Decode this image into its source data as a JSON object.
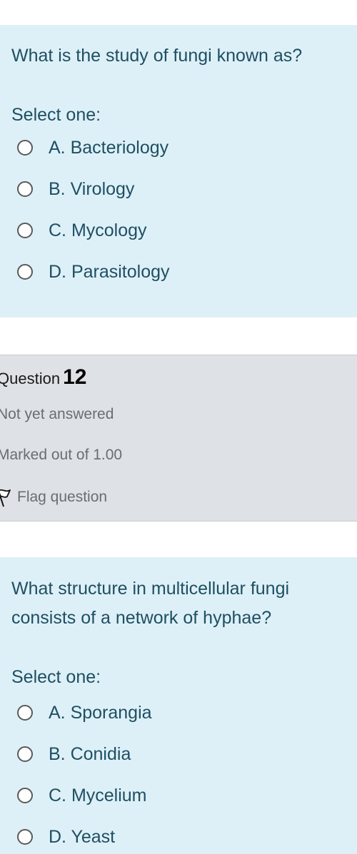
{
  "question11": {
    "text": "What is the study of fungi known as?",
    "select_label": "Select one:",
    "options": [
      {
        "label": "A. Bacteriology"
      },
      {
        "label": "B. Virology"
      },
      {
        "label": "C. Mycology"
      },
      {
        "label": "D. Parasitology"
      }
    ]
  },
  "question12_info": {
    "question_word": "Question",
    "number": "12",
    "status": "Not yet answered",
    "marks": "Marked out of 1.00",
    "flag_label": "Flag question",
    "flag_icon": "flag-outline-icon"
  },
  "question12": {
    "text": "What structure in multicellular fungi\nconsists of a network of hyphae?",
    "select_label": "Select one:",
    "options": [
      {
        "label": "A. Sporangia"
      },
      {
        "label": "B. Conidia"
      },
      {
        "label": "C. Mycelium"
      },
      {
        "label": "D. Yeast"
      }
    ]
  },
  "colors": {
    "question_bg": "#def0f7",
    "question_text": "#1e4f63",
    "info_bg": "#dee2e6",
    "muted_text": "#6a6d70"
  }
}
